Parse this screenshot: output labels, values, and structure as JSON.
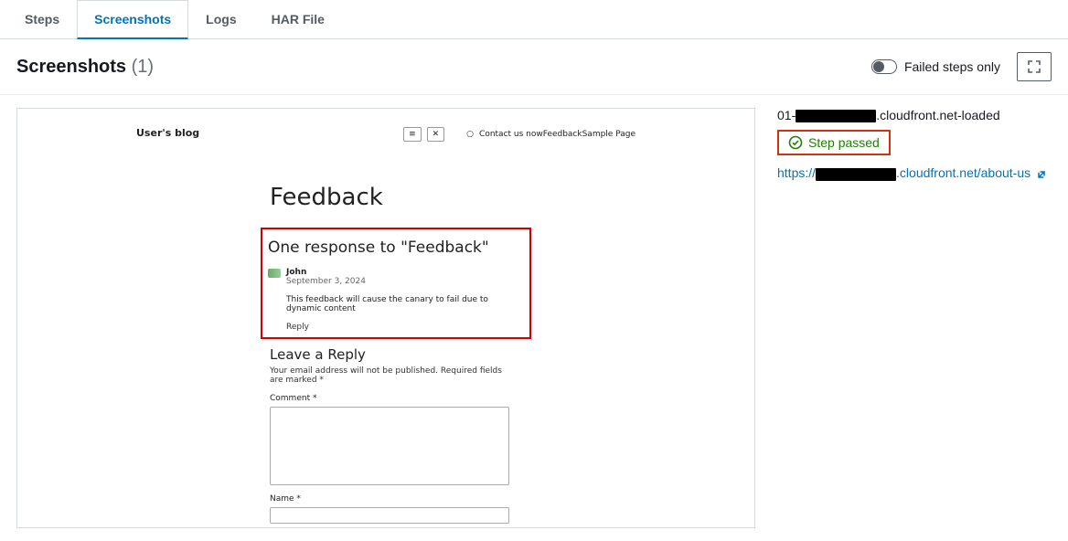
{
  "tabs": {
    "steps": "Steps",
    "screenshots": "Screenshots",
    "logs": "Logs",
    "har": "HAR File"
  },
  "header": {
    "title": "Screenshots",
    "count": "(1)",
    "toggle_label": "Failed steps only"
  },
  "side": {
    "step_prefix": "01-",
    "step_suffix": ".cloudfront.net-loaded",
    "status": "Step passed",
    "url_prefix": "https://",
    "url_suffix": ".cloudfront.net/about-us"
  },
  "blog": {
    "site_title": "User's blog",
    "nav_close": "✕",
    "nav_menu": "≡",
    "nav_bullet": "○",
    "nav_text": "Contact us nowFeedbackSample Page",
    "page_title": "Feedback",
    "responses_heading": "One response to \"Feedback\"",
    "comment": {
      "author": "John",
      "date": "September 3, 2024",
      "text": "This feedback will cause the canary to fail due to dynamic content",
      "reply": "Reply"
    },
    "reply_heading": "Leave a Reply",
    "reply_note": "Your email address will not be published. Required fields are marked *",
    "comment_label": "Comment *",
    "name_label": "Name *"
  }
}
